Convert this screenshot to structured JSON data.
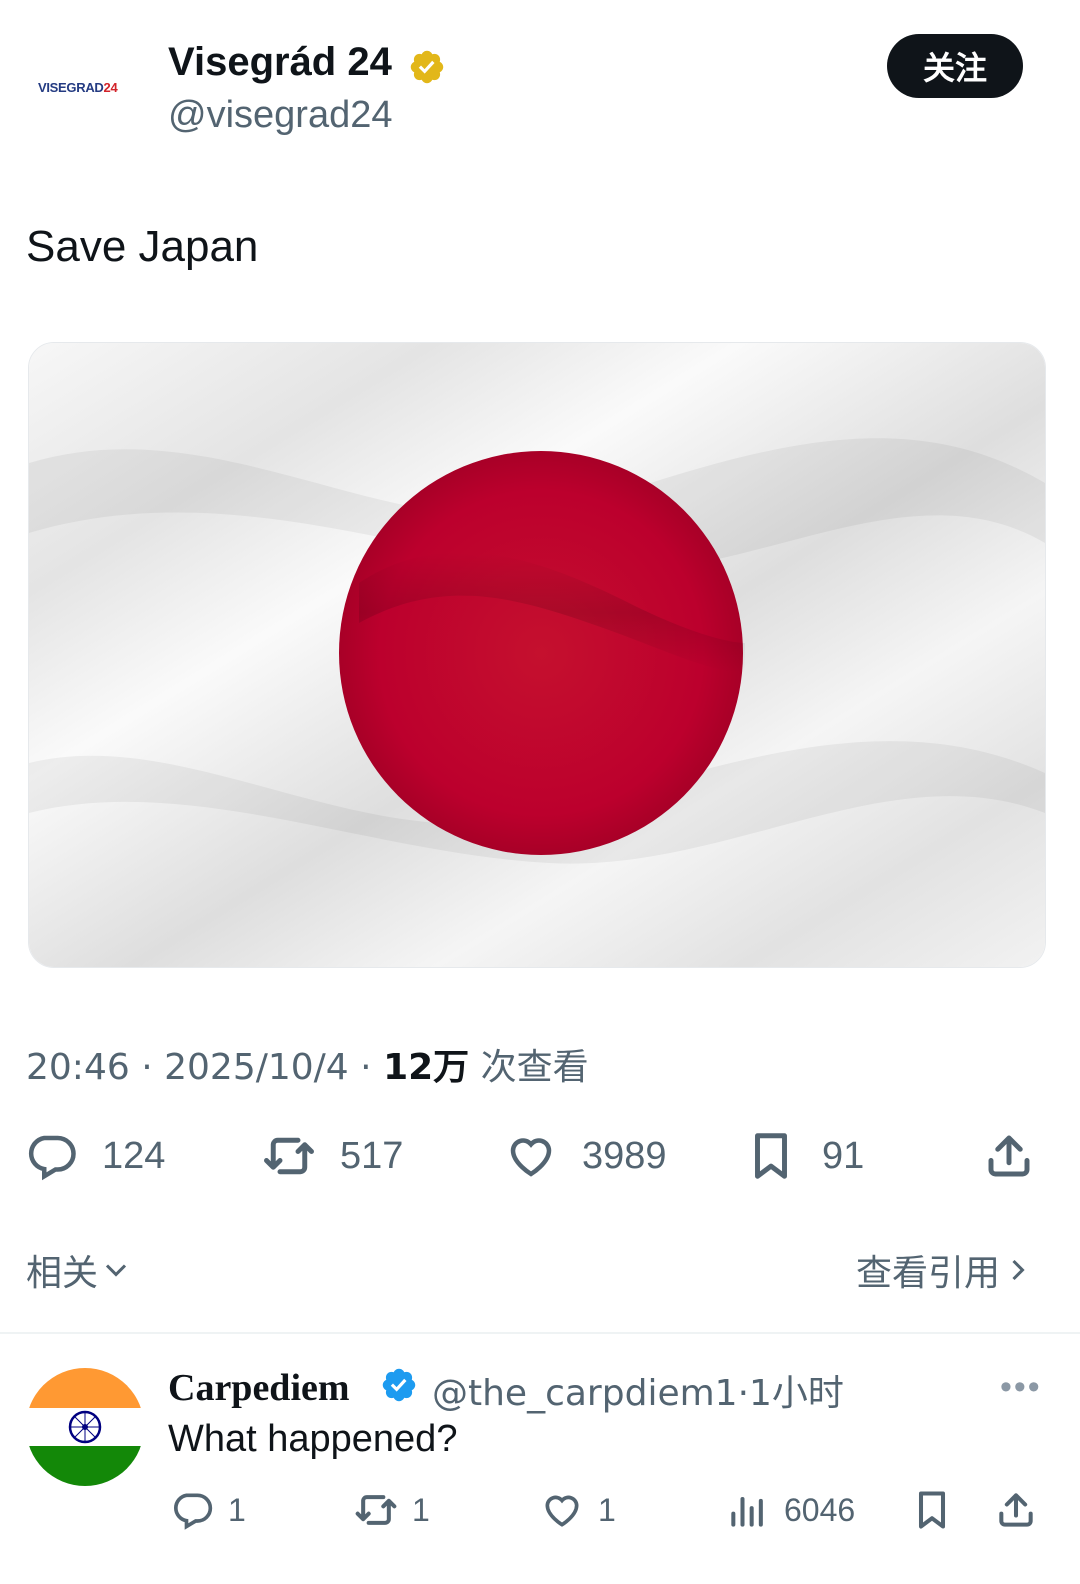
{
  "post": {
    "logo_text": "VISEGRAD",
    "logo_number": "24",
    "author_name": "Visegrád 24",
    "author_handle": "@visegrad24",
    "follow_label": "关注",
    "text": "Save Japan",
    "time": "20:46",
    "date": "2025/10/4",
    "views_count": "12万",
    "views_label": "次查看",
    "separator": "·",
    "actions": {
      "replies": "124",
      "reposts": "517",
      "likes": "3989",
      "bookmarks": "91"
    },
    "related_label": "相关",
    "view_quotes_label": "查看引用"
  },
  "reply": {
    "author_name": "Carpediem",
    "author_handle": "@the_carpdiem1",
    "time_ago": "1小时",
    "text": "What happened?",
    "actions": {
      "replies": "1",
      "reposts": "1",
      "likes": "1",
      "views": "6046"
    }
  },
  "colors": {
    "flag_red": "#bc002d",
    "verified_gold": "#e2b719",
    "verified_blue": "#1d9bf0",
    "india_saffron": "#ff9933",
    "india_green": "#138808",
    "india_chakra": "#000080"
  },
  "icons": [
    "verified-badge-icon",
    "reply-icon",
    "repost-icon",
    "like-icon",
    "bookmark-icon",
    "share-icon",
    "chevron-down-icon",
    "chevron-right-icon",
    "more-icon",
    "views-icon"
  ]
}
